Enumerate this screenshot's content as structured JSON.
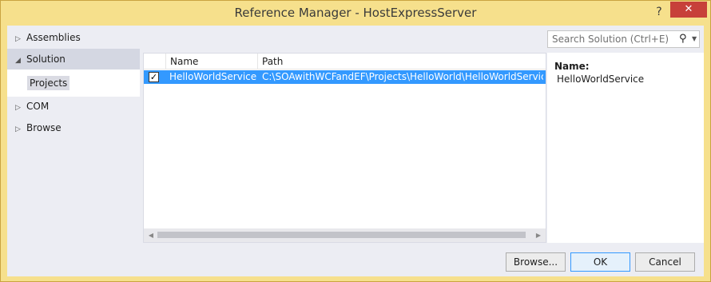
{
  "window": {
    "title": "Reference Manager - HostExpressServer",
    "help": "?",
    "close": "✕"
  },
  "nav": {
    "items": [
      {
        "label": "Assemblies",
        "expanded": false
      },
      {
        "label": "Solution",
        "expanded": true,
        "selected": true
      },
      {
        "label": "COM",
        "expanded": false
      },
      {
        "label": "Browse",
        "expanded": false
      }
    ],
    "sub_item": "Projects"
  },
  "search": {
    "placeholder": "Search Solution (Ctrl+E)",
    "icon": "search-icon"
  },
  "list": {
    "columns": [
      "Name",
      "Path"
    ],
    "rows": [
      {
        "checked": true,
        "name": "HelloWorldService",
        "path": "C:\\SOAwithWCFandEF\\Projects\\HelloWorld\\HelloWorldService\\H..."
      }
    ]
  },
  "details": {
    "label": "Name:",
    "value": "HelloWorldService"
  },
  "buttons": {
    "browse": "Browse...",
    "ok": "OK",
    "cancel": "Cancel"
  },
  "colors": {
    "titlebar": "#f6e08c",
    "selection": "#3399ff",
    "close": "#c7403a"
  }
}
